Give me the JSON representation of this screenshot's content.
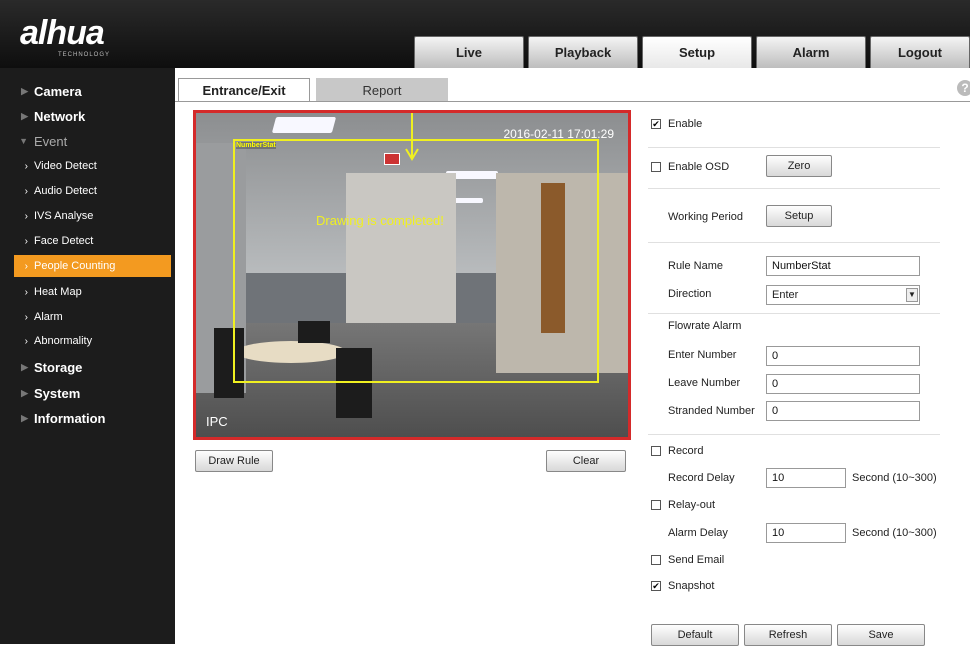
{
  "brand": {
    "logo": "alhua",
    "tagline": "TECHNOLOGY"
  },
  "top_nav": [
    "Live",
    "Playback",
    "Setup",
    "Alarm",
    "Logout"
  ],
  "sidebar": {
    "camera": "Camera",
    "network": "Network",
    "event": "Event",
    "event_items": [
      "Video Detect",
      "Audio Detect",
      "IVS Analyse",
      "Face Detect",
      "People Counting",
      "Heat Map",
      "Alarm",
      "Abnormality"
    ],
    "storage": "Storage",
    "system": "System",
    "information": "Information"
  },
  "tabs": {
    "entrance": "Entrance/Exit",
    "report": "Report"
  },
  "help": "?",
  "video": {
    "timestamp": "2016-02-11 17:01:29",
    "camera_name": "IPC",
    "rule_label": "NumberStat",
    "message": "Drawing is completed!"
  },
  "buttons": {
    "draw_rule": "Draw Rule",
    "clear": "Clear",
    "zero": "Zero",
    "setup": "Setup",
    "default": "Default",
    "refresh": "Refresh",
    "save": "Save"
  },
  "form": {
    "enable": "Enable",
    "enable_osd": "Enable OSD",
    "working_period": "Working Period",
    "rule_name_label": "Rule Name",
    "rule_name_value": "NumberStat",
    "direction_label": "Direction",
    "direction_value": "Enter",
    "flowrate_alarm": "Flowrate Alarm",
    "enter_number_label": "Enter Number",
    "enter_number_value": "0",
    "leave_number_label": "Leave Number",
    "leave_number_value": "0",
    "stranded_number_label": "Stranded Number",
    "stranded_number_value": "0",
    "record": "Record",
    "record_delay_label": "Record Delay",
    "record_delay_value": "10",
    "record_delay_unit": "Second (10~300)",
    "relay_out": "Relay-out",
    "alarm_delay_label": "Alarm Delay",
    "alarm_delay_value": "10",
    "alarm_delay_unit": "Second (10~300)",
    "send_email": "Send Email",
    "snapshot": "Snapshot"
  },
  "checks": {
    "enable": "✔",
    "snapshot": "✔"
  }
}
